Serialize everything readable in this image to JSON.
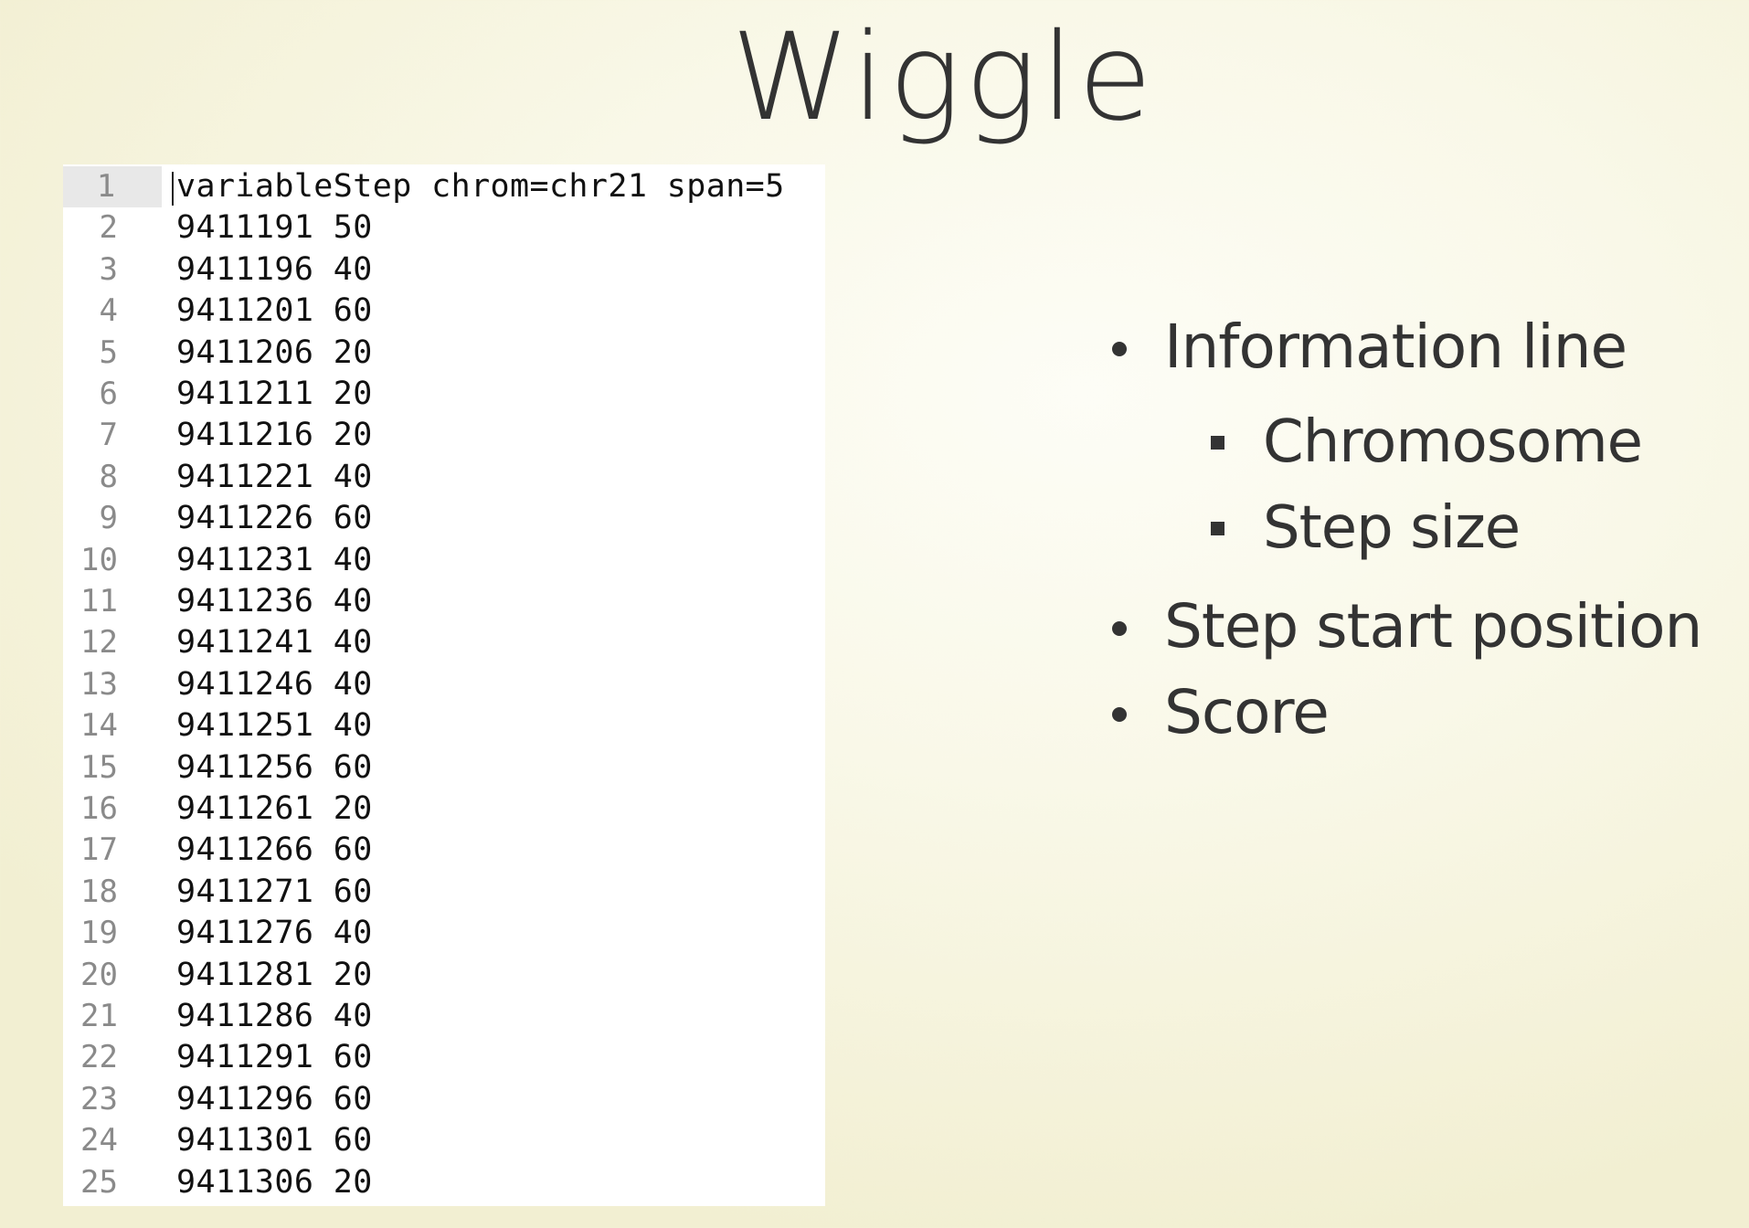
{
  "slide": {
    "title": "Wiggle"
  },
  "editor": {
    "lines": [
      {
        "number": "1",
        "text": "variableStep chrom=chr21 span=5"
      },
      {
        "number": "2",
        "text": "9411191 50"
      },
      {
        "number": "3",
        "text": "9411196 40"
      },
      {
        "number": "4",
        "text": "9411201 60"
      },
      {
        "number": "5",
        "text": "9411206 20"
      },
      {
        "number": "6",
        "text": "9411211 20"
      },
      {
        "number": "7",
        "text": "9411216 20"
      },
      {
        "number": "8",
        "text": "9411221 40"
      },
      {
        "number": "9",
        "text": "9411226 60"
      },
      {
        "number": "10",
        "text": "9411231 40"
      },
      {
        "number": "11",
        "text": "9411236 40"
      },
      {
        "number": "12",
        "text": "9411241 40"
      },
      {
        "number": "13",
        "text": "9411246 40"
      },
      {
        "number": "14",
        "text": "9411251 40"
      },
      {
        "number": "15",
        "text": "9411256 60"
      },
      {
        "number": "16",
        "text": "9411261 20"
      },
      {
        "number": "17",
        "text": "9411266 60"
      },
      {
        "number": "18",
        "text": "9411271 60"
      },
      {
        "number": "19",
        "text": "9411276 40"
      },
      {
        "number": "20",
        "text": "9411281 20"
      },
      {
        "number": "21",
        "text": "9411286 40"
      },
      {
        "number": "22",
        "text": "9411291 60"
      },
      {
        "number": "23",
        "text": "9411296 60"
      },
      {
        "number": "24",
        "text": "9411301 60"
      },
      {
        "number": "25",
        "text": "9411306 20"
      }
    ]
  },
  "bullets": [
    {
      "label": "Information line",
      "children": [
        {
          "label": "Chromosome"
        },
        {
          "label": "Step size"
        }
      ]
    },
    {
      "label": "Step start position",
      "children": []
    },
    {
      "label": "Score",
      "children": []
    }
  ],
  "colors": {
    "text": "#333333",
    "gutter_active": "#e8e8e8",
    "line_number": "#8a8a8a"
  }
}
